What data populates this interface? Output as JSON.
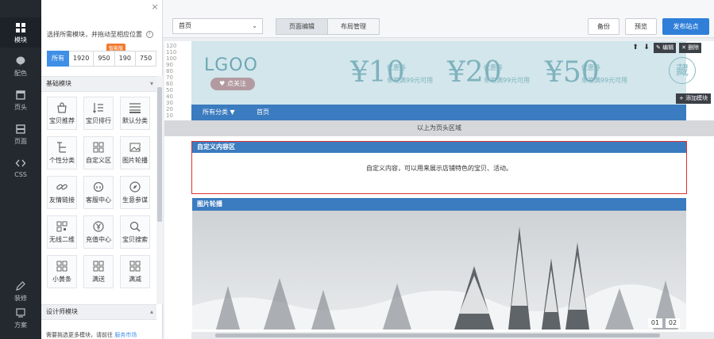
{
  "rail": {
    "items": [
      {
        "label": "模块",
        "icon": "grid-icon",
        "active": true
      },
      {
        "label": "配色",
        "icon": "palette-icon"
      },
      {
        "label": "页头",
        "icon": "header-icon"
      },
      {
        "label": "页面",
        "icon": "page-icon"
      },
      {
        "label": "CSS",
        "icon": "code-icon"
      },
      {
        "label": "装修",
        "icon": "edit-icon"
      },
      {
        "label": "方案",
        "icon": "plan-icon"
      }
    ]
  },
  "panel": {
    "close": "×",
    "hint": "选择所需模块，并拖动至相应位置",
    "help": "?",
    "filters": [
      "所有",
      "1920",
      "950",
      "190",
      "750"
    ],
    "filter_badge": "智能版",
    "basic_section": "基础模块",
    "designer_section": "设计师模块",
    "designer_sub_prefix": "需要挑选更多模块，请前往",
    "designer_sub_link": "服务市场",
    "tiles": [
      {
        "label": "宝贝推荐",
        "icon": "bag-icon"
      },
      {
        "label": "宝贝排行",
        "icon": "rank-icon"
      },
      {
        "label": "默认分类",
        "icon": "category-icon"
      },
      {
        "label": "个性分类",
        "icon": "tree-icon"
      },
      {
        "label": "自定义区",
        "icon": "custom-grid-icon"
      },
      {
        "label": "图片轮播",
        "icon": "image-icon"
      },
      {
        "label": "友情链接",
        "icon": "link-icon"
      },
      {
        "label": "客服中心",
        "icon": "headset-icon"
      },
      {
        "label": "生意参谋",
        "icon": "compass-icon"
      },
      {
        "label": "无线二维",
        "icon": "qrcode-icon"
      },
      {
        "label": "充值中心",
        "icon": "yen-icon"
      },
      {
        "label": "宝贝搜索",
        "icon": "search-icon"
      },
      {
        "label": "小黄条",
        "icon": "grid-icon"
      },
      {
        "label": "满送",
        "icon": "grid-icon"
      },
      {
        "label": "满减",
        "icon": "grid-icon"
      }
    ]
  },
  "toolbar": {
    "page_select": "首页",
    "tab_edit": "页面编辑",
    "tab_layout": "布局管理",
    "backup": "备份",
    "preview": "预览",
    "publish": "发布站点"
  },
  "canvas": {
    "ruler": [
      "120",
      "110",
      "100",
      "90",
      "80",
      "70",
      "60",
      "50",
      "40",
      "30",
      "20",
      "10"
    ],
    "logo": "LGOO",
    "follow": "♥ 点关注",
    "coupons": [
      {
        "symbol": "¥",
        "amount": "10",
        "label": "优惠券",
        "condition": "单笔满99元可用"
      },
      {
        "symbol": "¥",
        "amount": "20",
        "label": "优惠券",
        "condition": "单笔满99元可用"
      },
      {
        "symbol": "¥",
        "amount": "50",
        "label": "优惠券",
        "condition": "单笔满99元可用"
      }
    ],
    "collect": "藏",
    "edit_tool": "✎ 编辑",
    "delete_tool": "✕ 删除",
    "add_module": "+ 添加模块",
    "nav_all": "所有分类 ▼",
    "nav_home": "首页",
    "header_divider": "以上为页头区域",
    "custom_title": "自定义内容区",
    "custom_body": "自定义内容，可以用来展示店铺特色的宝贝、活动。",
    "carousel_title": "图片轮播",
    "pages": [
      "01",
      "02"
    ]
  }
}
